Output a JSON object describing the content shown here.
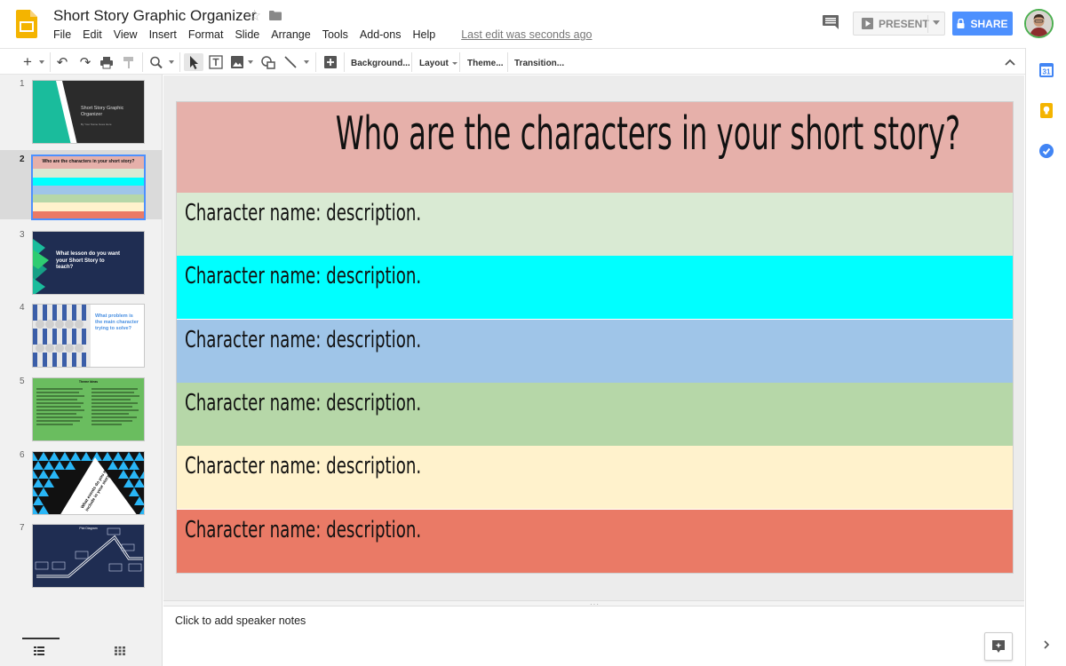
{
  "app": {
    "doc_title": "Short Story Graphic Organizer",
    "last_edit": "Last edit was seconds ago",
    "menus": [
      "File",
      "Edit",
      "View",
      "Insert",
      "Format",
      "Slide",
      "Arrange",
      "Tools",
      "Add-ons",
      "Help"
    ],
    "present_label": "PRESENT",
    "share_label": "SHARE",
    "brand_color": "#f4b400",
    "accent_color": "#4d90fe"
  },
  "toolbar": {
    "background_label": "Background...",
    "layout_label": "Layout",
    "theme_label": "Theme...",
    "transition_label": "Transition..."
  },
  "side_panel": {
    "calendar_day": "31",
    "icons": [
      "calendar-icon",
      "keep-icon",
      "tasks-icon",
      "expand-right-icon"
    ]
  },
  "filmstrip": {
    "selected_slide": 2,
    "slides": [
      {
        "number": "1",
        "kind": "title",
        "title": "Short Story Graphic Organizer",
        "subtitle": "By Your Name Goes Here"
      },
      {
        "number": "2",
        "kind": "characters",
        "title": "Who are the characters in your short story?"
      },
      {
        "number": "3",
        "kind": "lesson",
        "title": "What lesson do you want your Short Story to teach?"
      },
      {
        "number": "4",
        "kind": "problem",
        "title": "What problem is the main character trying to solve?"
      },
      {
        "number": "5",
        "kind": "themes",
        "title": "Theme Ideas"
      },
      {
        "number": "6",
        "kind": "triangles",
        "title": "What events do you want to include in your story?"
      },
      {
        "number": "7",
        "kind": "plot",
        "title": "Plot Diagram"
      }
    ]
  },
  "slide": {
    "title": "Who are the characters in your short story?",
    "title_bg": "#e6b0aa",
    "rows": [
      {
        "text": "Character name: description.",
        "color": "#d9ead3"
      },
      {
        "text": "Character name: description.",
        "color": "#00ffff"
      },
      {
        "text": "Character name: description.",
        "color": "#9fc5e8"
      },
      {
        "text": "Character name: description.",
        "color": "#b6d7a8"
      },
      {
        "text": "Character name: description.",
        "color": "#fff2cc"
      },
      {
        "text": "Character name: description.",
        "color": "#ea7a66"
      }
    ]
  },
  "notes": {
    "placeholder": "Click to add speaker notes"
  }
}
